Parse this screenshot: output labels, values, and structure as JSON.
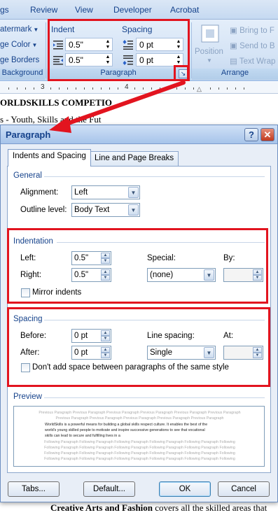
{
  "ribbon_tabs": [
    "gs",
    "Review",
    "View",
    "Developer",
    "Acrobat"
  ],
  "ribbon_left": {
    "watermark": "atermark",
    "page_color": "ge Color",
    "page_borders": "ge Borders",
    "group_label": "Background"
  },
  "ribbon_paragraph": {
    "indent_title": "Indent",
    "spacing_title": "Spacing",
    "indent_left": "0.5\"",
    "indent_right": "0.5\"",
    "spacing_before": "0 pt",
    "spacing_after": "0 pt",
    "group_label": "Paragraph"
  },
  "ribbon_arrange": {
    "position": "Position",
    "bring_to_front": "Bring to F",
    "send_to_back": "Send to B",
    "text_wrap": "Text Wrap",
    "group_label": "Arrange"
  },
  "ruler": {
    "numbers": [
      "3",
      "4"
    ]
  },
  "document": {
    "heading": "ORLDSKILLS COMPETIO",
    "line2": "s - Youth, Skills and the Fut",
    "footer_bold": "Creative Arts and Fashion",
    "footer_rest": " covers all the skilled areas that"
  },
  "dialog": {
    "title": "Paragraph",
    "help": "?",
    "close": "✕",
    "tabs": [
      "Indents and Spacing",
      "Line and Page Breaks"
    ],
    "general": {
      "section": "General",
      "alignment_label": "Alignment:",
      "alignment_value": "Left",
      "outline_label": "Outline level:",
      "outline_value": "Body Text"
    },
    "indentation": {
      "section": "Indentation",
      "left_label": "Left:",
      "left_value": "0.5\"",
      "right_label": "Right:",
      "right_value": "0.5\"",
      "special_label": "Special:",
      "special_value": "(none)",
      "by_label": "By:",
      "by_value": "",
      "mirror_label": "Mirror indents"
    },
    "spacing": {
      "section": "Spacing",
      "before_label": "Before:",
      "before_value": "0 pt",
      "after_label": "After:",
      "after_value": "0 pt",
      "line_spacing_label": "Line spacing:",
      "line_spacing_value": "Single",
      "at_label": "At:",
      "at_value": "",
      "dont_add_label": "Don't add space between paragraphs of the same style"
    },
    "preview": {
      "section": "Preview",
      "lines": [
        "Previous Paragraph Previous Paragraph Previous Paragraph Previous Paragraph Previous Paragraph Previous Paragraph",
        "Previous Paragraph Previous Paragraph Previous Paragraph Previous Paragraph Previous Paragraph"
      ],
      "sample": [
        "WorldSkills is a powerful means for building a global skills respect culture. It enables the best of the",
        "world's young skilled people to motivate and inspire successive generations to see that vocational",
        "skills can lead to secure and fulfilling lives in a"
      ],
      "following": "Following Paragraph Following Paragraph Following Paragraph Following Paragraph Following Paragraph Following"
    },
    "buttons": {
      "tabs": "Tabs...",
      "default": "Default...",
      "ok": "OK",
      "cancel": "Cancel"
    }
  },
  "colors": {
    "highlight": "#e2141f",
    "accent": "#15428b"
  }
}
